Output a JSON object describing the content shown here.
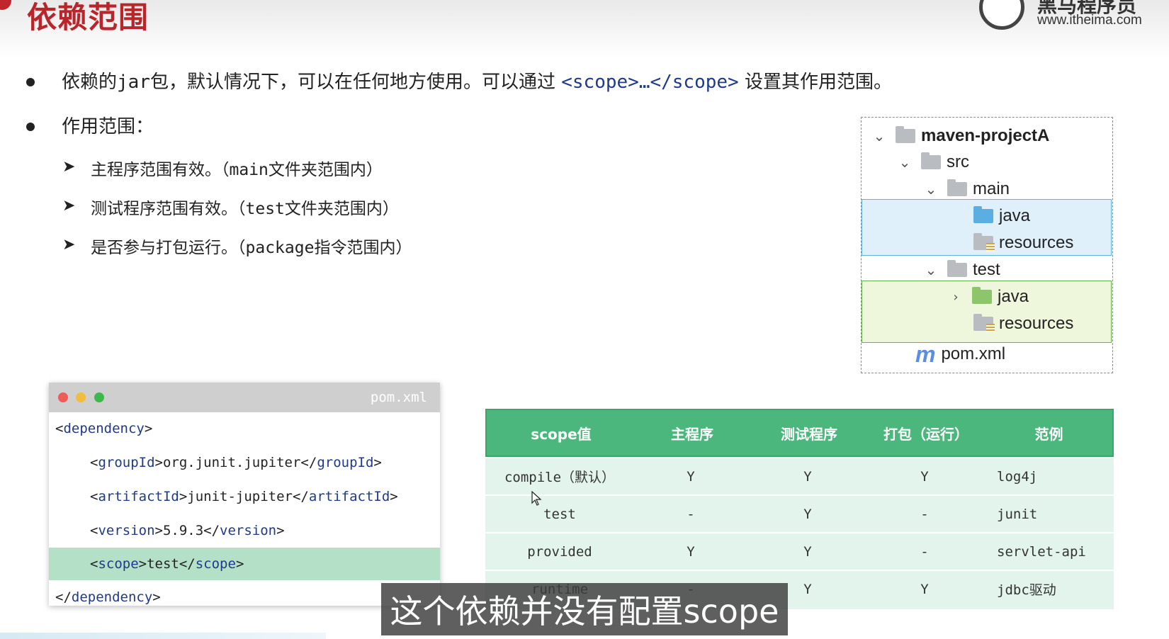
{
  "slide": {
    "title": "依赖范围",
    "logo": {
      "name": "黑马程序员",
      "url": "www.itheima.com"
    }
  },
  "bullets": {
    "b1": {
      "prefix": "依赖的",
      "jar": "jar",
      "mid": "包，默认情况下，可以在任何地方使用。可以通过 ",
      "code": "<scope>…</scope>",
      "suffix": " 设置其作用范围。"
    },
    "b2": {
      "text": "作用范围："
    }
  },
  "subitems": [
    {
      "text_a": "主程序范围有效。（",
      "mono": "main",
      "text_b": "文件夹范围内）"
    },
    {
      "text_a": "测试程序范围有效。（",
      "mono": "test",
      "text_b": "文件夹范围内）"
    },
    {
      "text_a": "是否参与打包运行。（",
      "mono": "package",
      "text_b": "指令范围内）"
    }
  ],
  "tree": {
    "project": "maven-projectA",
    "src": "src",
    "main": "main",
    "main_java": "java",
    "main_resources": "resources",
    "test": "test",
    "test_java": "java",
    "test_resources": "resources",
    "pom": "pom.xml"
  },
  "code": {
    "filename": "pom.xml",
    "lines": [
      {
        "open": "<",
        "tag": "dependency",
        "close": ">"
      },
      {
        "a": "<",
        "tag": "groupId",
        "b": ">org.junit.jupiter</",
        "tag2": "groupId",
        "c": ">"
      },
      {
        "a": "<",
        "tag": "artifactId",
        "b": ">junit-jupiter</",
        "tag2": "artifactId",
        "c": ">"
      },
      {
        "a": "<",
        "tag": "version",
        "b": ">5.9.3</",
        "tag2": "version",
        "c": ">"
      },
      {
        "a": "<",
        "tag": "scope",
        "b": ">test</",
        "tag2": "scope",
        "c": ">"
      },
      {
        "open": "</",
        "tag": "dependency",
        "close": ">"
      }
    ]
  },
  "scope_table": {
    "headers": [
      "scope值",
      "主程序",
      "测试程序",
      "打包（运行）",
      "范例"
    ],
    "rows": [
      [
        "compile（默认）",
        "Y",
        "Y",
        "Y",
        "log4j"
      ],
      [
        "test",
        "-",
        "Y",
        "-",
        "junit"
      ],
      [
        "provided",
        "Y",
        "Y",
        "-",
        "servlet-api"
      ],
      [
        "runtime",
        "-",
        "Y",
        "Y",
        "jdbc驱动"
      ]
    ]
  },
  "subtitle": "这个依赖并没有配置scope",
  "colors": {
    "title_red": "#b8262b",
    "table_header_green": "#4bb77c",
    "table_body_green": "#e3f4ec",
    "code_tag_blue": "#1f3a8a",
    "code_highlight": "#b3e0c6"
  }
}
